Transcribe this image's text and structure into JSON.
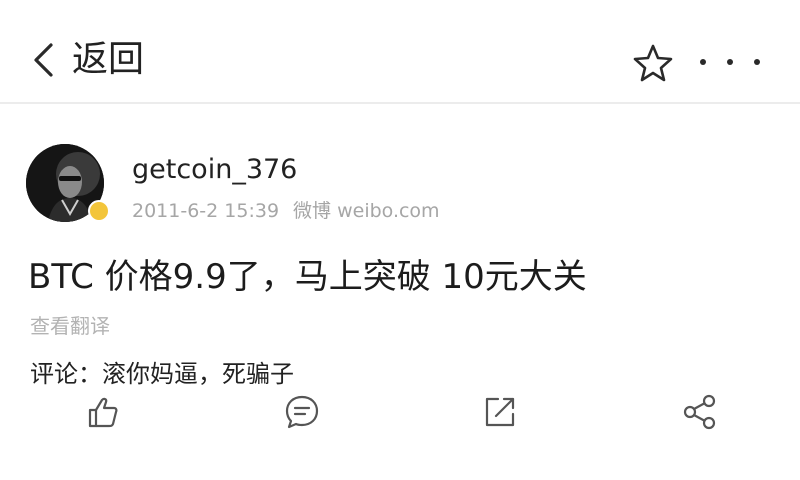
{
  "nav": {
    "back_icon": "chevron-left-icon",
    "back_label": "返回",
    "favorite_icon": "star-outline-icon",
    "more_icon": "more-dots-icon"
  },
  "post": {
    "author": "getcoin_376",
    "timestamp": "2011-6-2 15:39",
    "source": "微博 weibo.com",
    "text": "BTC 价格9.9了，马上突破 10元大关",
    "translate_label": "查看翻译",
    "comment": "评论：滚你妈逼，死骗子"
  },
  "actions": {
    "like_icon": "thumbs-up-icon",
    "comment_icon": "comment-bubble-icon",
    "repost_icon": "repost-arrow-icon",
    "share_icon": "share-icon"
  },
  "colors": {
    "text": "#1f1f1f",
    "muted": "#a6a6a6",
    "divider": "#ececec",
    "badge": "#f3c53a"
  }
}
